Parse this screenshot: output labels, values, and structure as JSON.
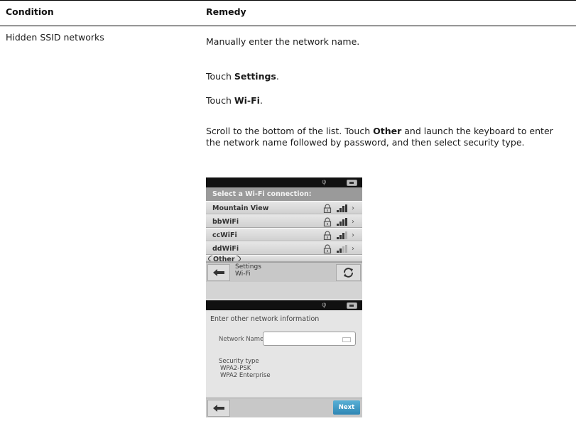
{
  "table": {
    "headers": {
      "condition": "Condition",
      "remedy": "Remedy"
    },
    "row": {
      "condition": "Hidden SSID networks",
      "steps": {
        "s1": "Manually enter the network name.",
        "s2_pre": "Touch ",
        "s2_bold": "Settings",
        "s2_post": ".",
        "s3_pre": "Touch ",
        "s3_bold": "Wi-Fi",
        "s3_post": ".",
        "s4_pre": "Scroll to the bottom of the list. Touch ",
        "s4_bold": "Other",
        "s4_post": " and launch the keyboard to enter the network name followed by password, and then select security type."
      }
    }
  },
  "screen1": {
    "list_header": "Select a Wi-Fi connection:",
    "networks": [
      "Mountain View",
      "bbWiFi",
      "ccWiFi",
      "ddWiFi"
    ],
    "other": "Other",
    "breadcrumb_line1": "Settings",
    "breadcrumb_line2": "Wi-Fi"
  },
  "screen2": {
    "title": "Enter other network information",
    "network_name_label": "Network Name",
    "security_label": "Security type",
    "security_options": [
      "WPA2-PSK",
      "WPA2 Enterprise"
    ],
    "next_label": "Next"
  }
}
